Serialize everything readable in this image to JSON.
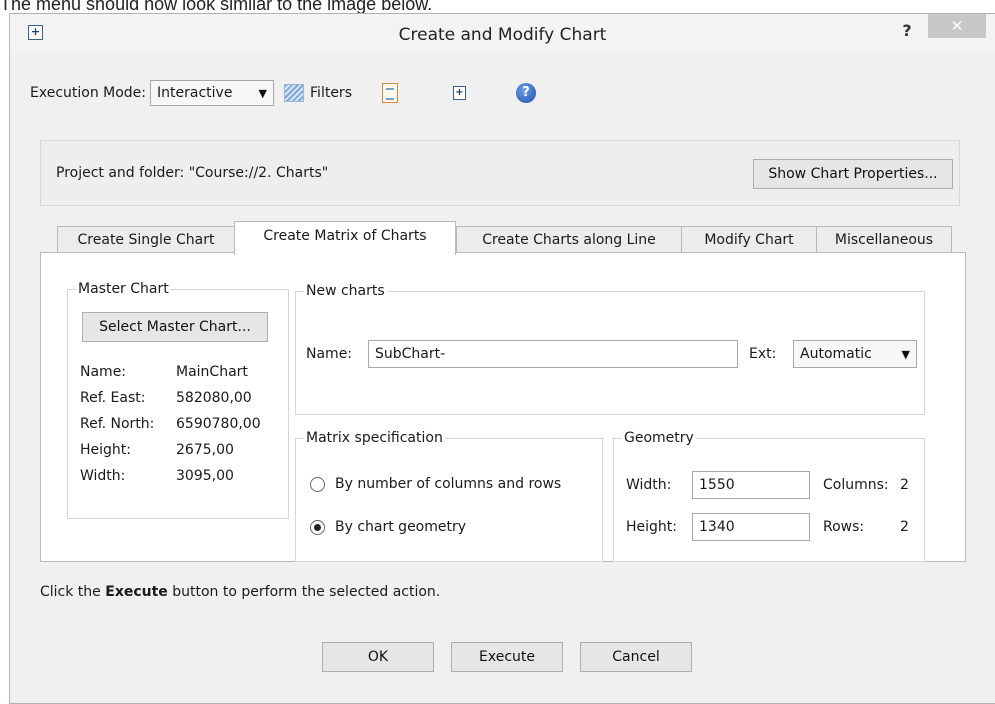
{
  "caption": "The menu should now look similar to the image below.",
  "window": {
    "title": "Create and Modify Chart",
    "help_glyph": "?",
    "close_glyph": "✕"
  },
  "toolbar": {
    "execution_mode_label": "Execution Mode:",
    "execution_mode_value": "Interactive",
    "filters_label": "Filters",
    "icons": [
      "filters-icon",
      "report-icon",
      "new-chart-icon",
      "help-icon"
    ]
  },
  "project": {
    "text": "Project and folder: \"Course://2. Charts\"",
    "show_properties_button": "Show Chart Properties..."
  },
  "tabs": [
    {
      "label": "Create Single Chart",
      "active": false
    },
    {
      "label": "Create Matrix of Charts",
      "active": true
    },
    {
      "label": "Create Charts along Line",
      "active": false
    },
    {
      "label": "Modify Chart",
      "active": false
    },
    {
      "label": "Miscellaneous",
      "active": false
    }
  ],
  "master_chart": {
    "legend": "Master Chart",
    "select_button": "Select Master Chart...",
    "rows": [
      {
        "key": "Name:",
        "value": "MainChart"
      },
      {
        "key": "Ref. East:",
        "value": "582080,00"
      },
      {
        "key": "Ref. North:",
        "value": "6590780,00"
      },
      {
        "key": "Height:",
        "value": "2675,00"
      },
      {
        "key": "Width:",
        "value": "3095,00"
      }
    ]
  },
  "new_charts": {
    "legend": "New charts",
    "name_label": "Name:",
    "name_value": "SubChart-",
    "ext_label": "Ext:",
    "ext_value": "Automatic"
  },
  "matrix_spec": {
    "legend": "Matrix specification",
    "options": [
      {
        "label": "By number of columns and rows",
        "checked": false
      },
      {
        "label": "By chart geometry",
        "checked": true
      }
    ]
  },
  "geometry": {
    "legend": "Geometry",
    "width_label": "Width:",
    "width_value": "1550",
    "height_label": "Height:",
    "height_value": "1340",
    "columns_label": "Columns:",
    "columns_value": "2",
    "rows_label": "Rows:",
    "rows_value": "2"
  },
  "footer": {
    "hint_prefix": "Click the ",
    "hint_bold": "Execute",
    "hint_suffix": " button to perform the selected action.",
    "buttons": {
      "ok": "OK",
      "execute": "Execute",
      "cancel": "Cancel"
    }
  }
}
